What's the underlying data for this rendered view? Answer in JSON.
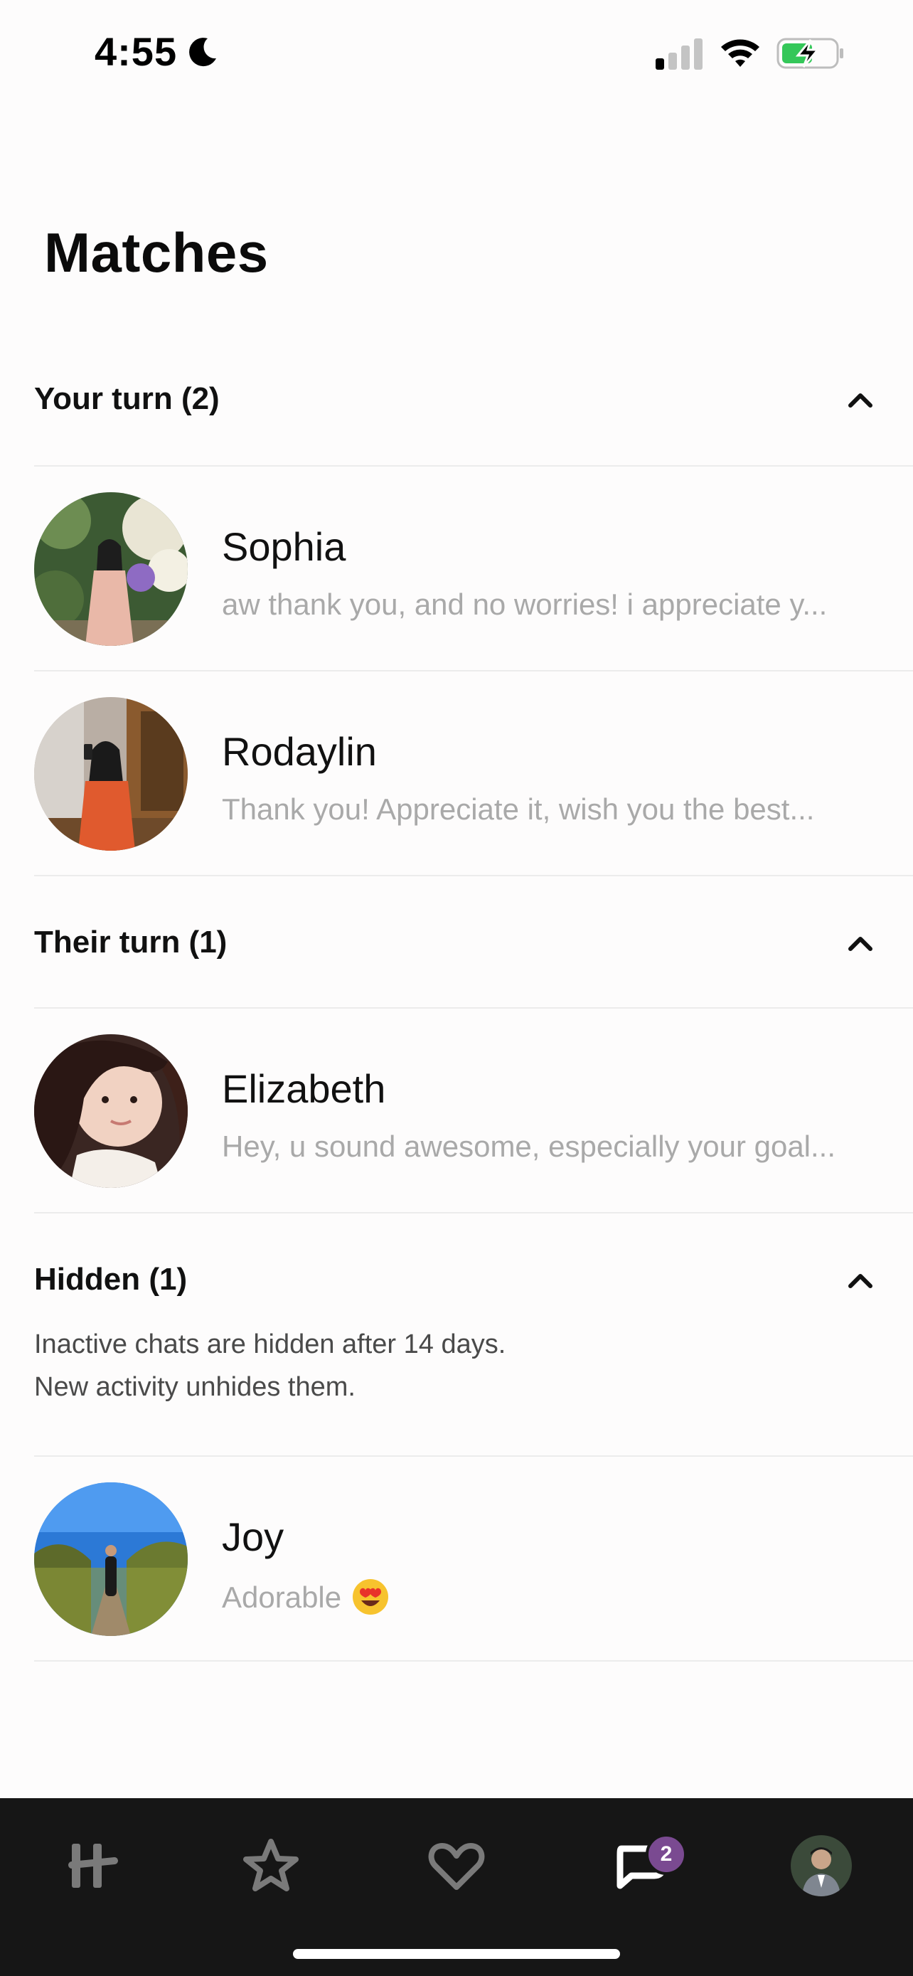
{
  "status_bar": {
    "time": "4:55",
    "icons": [
      "moon-icon",
      "signal-icon",
      "wifi-icon",
      "battery-charging-icon"
    ]
  },
  "page": {
    "title": "Matches"
  },
  "sections": {
    "your_turn": {
      "title": "Your turn (2)",
      "icon": "chevron-up-icon"
    },
    "their_turn": {
      "title": "Their turn (1)",
      "icon": "chevron-up-icon"
    },
    "hidden": {
      "title": "Hidden (1)",
      "icon": "chevron-up-icon",
      "note_line1": "Inactive chats are hidden after 14 days.",
      "note_line2": "New activity unhides them."
    }
  },
  "matches": [
    {
      "name": "Sophia",
      "preview": "aw thank you, and no worries! i appreciate y..."
    },
    {
      "name": "Rodaylin",
      "preview": "Thank you! Appreciate it, wish you the best..."
    },
    {
      "name": "Elizabeth",
      "preview": "Hey, u sound awesome, especially your goal..."
    },
    {
      "name": "Joy",
      "preview": "Adorable",
      "emoji": "heart-eyes-icon"
    }
  ],
  "bottom_nav": {
    "items": [
      "hinge-home-icon",
      "star-icon",
      "heart-icon",
      "chat-icon",
      "profile-avatar"
    ],
    "chat_badge": "2",
    "active": "chat-icon"
  },
  "colors": {
    "background": "#fdfcfc",
    "nav_background": "#161616",
    "badge": "#7a4a91",
    "preview_text": "#a9a9a9",
    "battery_green": "#34c759"
  }
}
